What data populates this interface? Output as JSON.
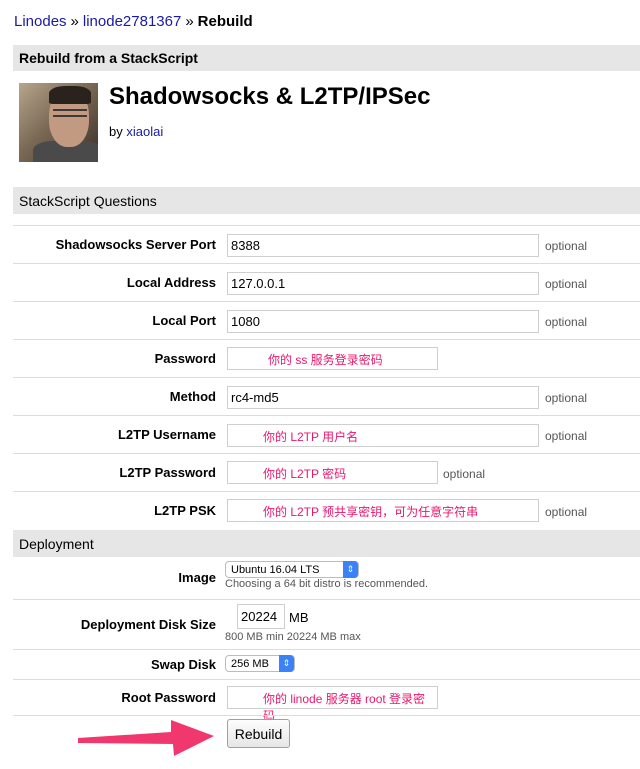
{
  "breadcrumb": {
    "linodes": "Linodes",
    "sep1": "»",
    "linode": "linode2781367",
    "sep2": "»",
    "current": "Rebuild"
  },
  "section_title": "Rebuild from a StackScript",
  "stackscript": {
    "title": "Shadowsocks & L2TP/IPSec",
    "by_label": "by",
    "author": "xiaolai"
  },
  "questions": {
    "header": "StackScript Questions",
    "rows": [
      {
        "label": "Shadowsocks Server Port",
        "value": "8388",
        "optional": "optional"
      },
      {
        "label": "Local Address",
        "value": "127.0.0.1",
        "optional": "optional"
      },
      {
        "label": "Local Port",
        "value": "1080",
        "optional": "optional"
      },
      {
        "label": "Password",
        "annotation": "你的 ss 服务登录密码"
      },
      {
        "label": "Method",
        "value": "rc4-md5",
        "optional": "optional"
      },
      {
        "label": "L2TP Username",
        "annotation": "你的 L2TP 用户名",
        "optional": "optional"
      },
      {
        "label": "L2TP Password",
        "annotation": "你的 L2TP 密码",
        "optional": "optional"
      },
      {
        "label": "L2TP PSK",
        "annotation": "你的 L2TP 预共享密钥，可为任意字符串",
        "optional": "optional"
      }
    ]
  },
  "deployment": {
    "header": "Deployment",
    "image": {
      "label": "Image",
      "selected": "Ubuntu 16.04 LTS",
      "hint": "Choosing a 64 bit distro is recommended."
    },
    "disk": {
      "label": "Deployment Disk Size",
      "value": "20224",
      "unit": "MB",
      "hint": "800 MB min 20224 MB max"
    },
    "swap": {
      "label": "Swap Disk",
      "selected": "256 MB"
    },
    "root": {
      "label": "Root Password",
      "annotation": "你的 linode 服务器 root 登录密码"
    }
  },
  "rebuild_button": "Rebuild",
  "colors": {
    "annotation": "#e8186d",
    "arrow": "#f0386e",
    "link": "#1a1aa6"
  },
  "icons": {
    "select_chevron": "up-down-chevron-icon",
    "arrow": "pointing-arrow-icon"
  }
}
